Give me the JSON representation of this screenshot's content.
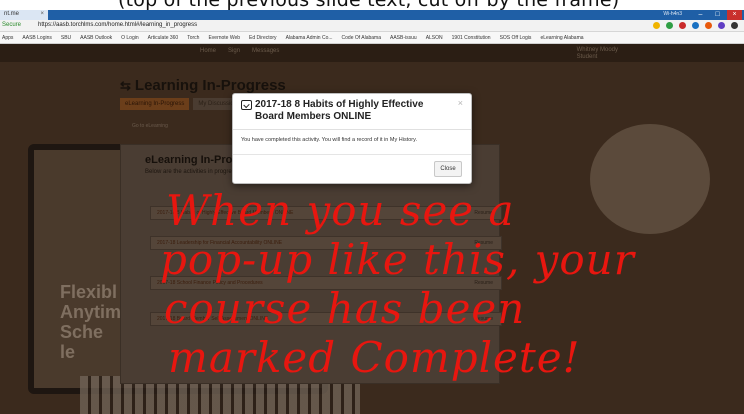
{
  "caption": "(top of the previous slide text, cut off by the frame)",
  "browser": {
    "tab_label": "nt.me",
    "window_user": "Wi-h4n3",
    "secure_label": "Secure",
    "url": "https://aasb.torchlms.com/home.html#/learning_in_progress",
    "bookmarks": [
      "Apps",
      "AASB Logins",
      "SBU",
      "AASB Outlook",
      "O Login",
      "Articulate 360",
      "Torch",
      "Evernote Web",
      "Ed Directory",
      "Alabama Admin Co...",
      "Code Of Alabama",
      "AASB-issuu",
      "ALSON",
      "1901 Constitution",
      "SOS Off Logis",
      "eLearning Alabama"
    ]
  },
  "page": {
    "nav_items": [
      "Home",
      "Sign",
      "Messages"
    ],
    "user_name": "Whitney Moody",
    "user_sub": "Student",
    "title": "Learning In-Progress",
    "tabs": [
      "eLearning In-Progress",
      "My Discussions"
    ],
    "sub_link": "Go to eLearning",
    "section_title": "eLearning In-Progress",
    "section_desc": "Below are the activities in progress",
    "rows": [
      {
        "label": "2017-18 8 Habits of Highly Effective Board Members ONLINE",
        "status": "Resume"
      },
      {
        "label": "2017-18 Leadership for Financial Accountability ONLINE",
        "status": "Resume"
      },
      {
        "label": "2017-18 School Finance Policy and Procedures",
        "status": "Resume"
      },
      {
        "label": "2017-18 Board Member Self Assessment ONLINE",
        "status": "Resume"
      }
    ],
    "laptop_words": [
      "Flexibl",
      "Anytim",
      "Sche",
      "le"
    ]
  },
  "modal": {
    "title": "2017-18 8 Habits of Highly Effective Board Members ONLINE",
    "message": "You have completed this activity. You will find a record of it in My History.",
    "close_label": "Close",
    "close_x": "×"
  },
  "annotation": {
    "lines": [
      "When you see a",
      "pop-up like this, your",
      "course has been",
      "marked Complete!"
    ]
  },
  "colors": {
    "annotation": "#e8160f",
    "tabbar": "#1f5fa6",
    "active_tab": "#6b3e1a"
  }
}
